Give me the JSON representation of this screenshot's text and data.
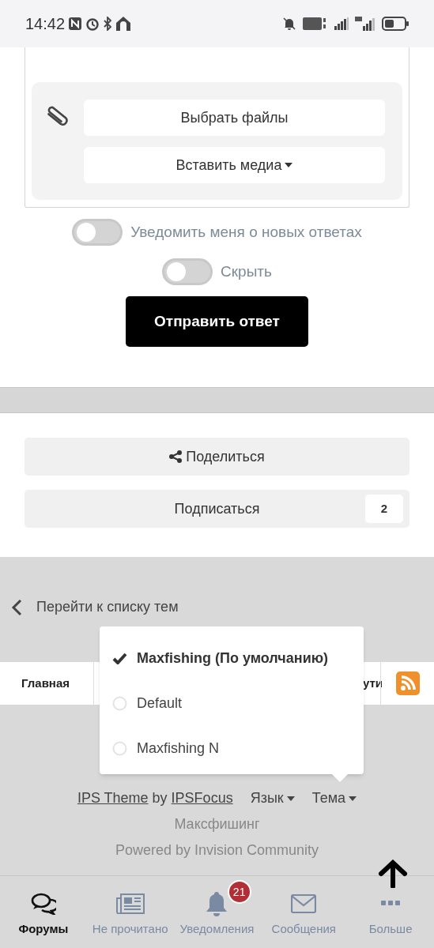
{
  "status_bar": {
    "time": "14:42"
  },
  "attachments": {
    "choose_files": "Выбрать файлы",
    "insert_media": "Вставить медиа"
  },
  "toggles": [
    {
      "label": "Уведомить меня о новых ответах",
      "on": false
    },
    {
      "label": "Скрыть",
      "on": false
    }
  ],
  "submit_button": "Отправить ответ",
  "actions": {
    "share": "Поделиться",
    "subscribe": "Подписаться",
    "subscribe_count": "2"
  },
  "back_link": "Перейти к списку тем",
  "breadcrumbs": [
    "Главная",
    "ути"
  ],
  "theme_menu": [
    {
      "label": "Maxfishing (По умолчанию)",
      "selected": true
    },
    {
      "label": "Default",
      "selected": false
    },
    {
      "label": "Maxfishing N",
      "selected": false
    }
  ],
  "footer": {
    "credit": [
      {
        "text": "IPS Theme",
        "link": true
      },
      {
        "text": "by",
        "link": false
      },
      {
        "text": "IPSFocus",
        "link": true
      }
    ],
    "language": "Язык",
    "theme": "Тема",
    "site_name": "Максфишинг",
    "powered_by": "Powered by Invision Community"
  },
  "bottom_nav": [
    {
      "label": "Форумы",
      "kind": "chat",
      "selected": true
    },
    {
      "label": "Не прочитано",
      "kind": "news",
      "selected": false
    },
    {
      "label": "Уведомления",
      "kind": "bell",
      "selected": false,
      "badge": "21"
    },
    {
      "label": "Сообщения",
      "kind": "mail",
      "selected": false
    },
    {
      "label": "Больше",
      "kind": "more",
      "selected": false
    }
  ]
}
